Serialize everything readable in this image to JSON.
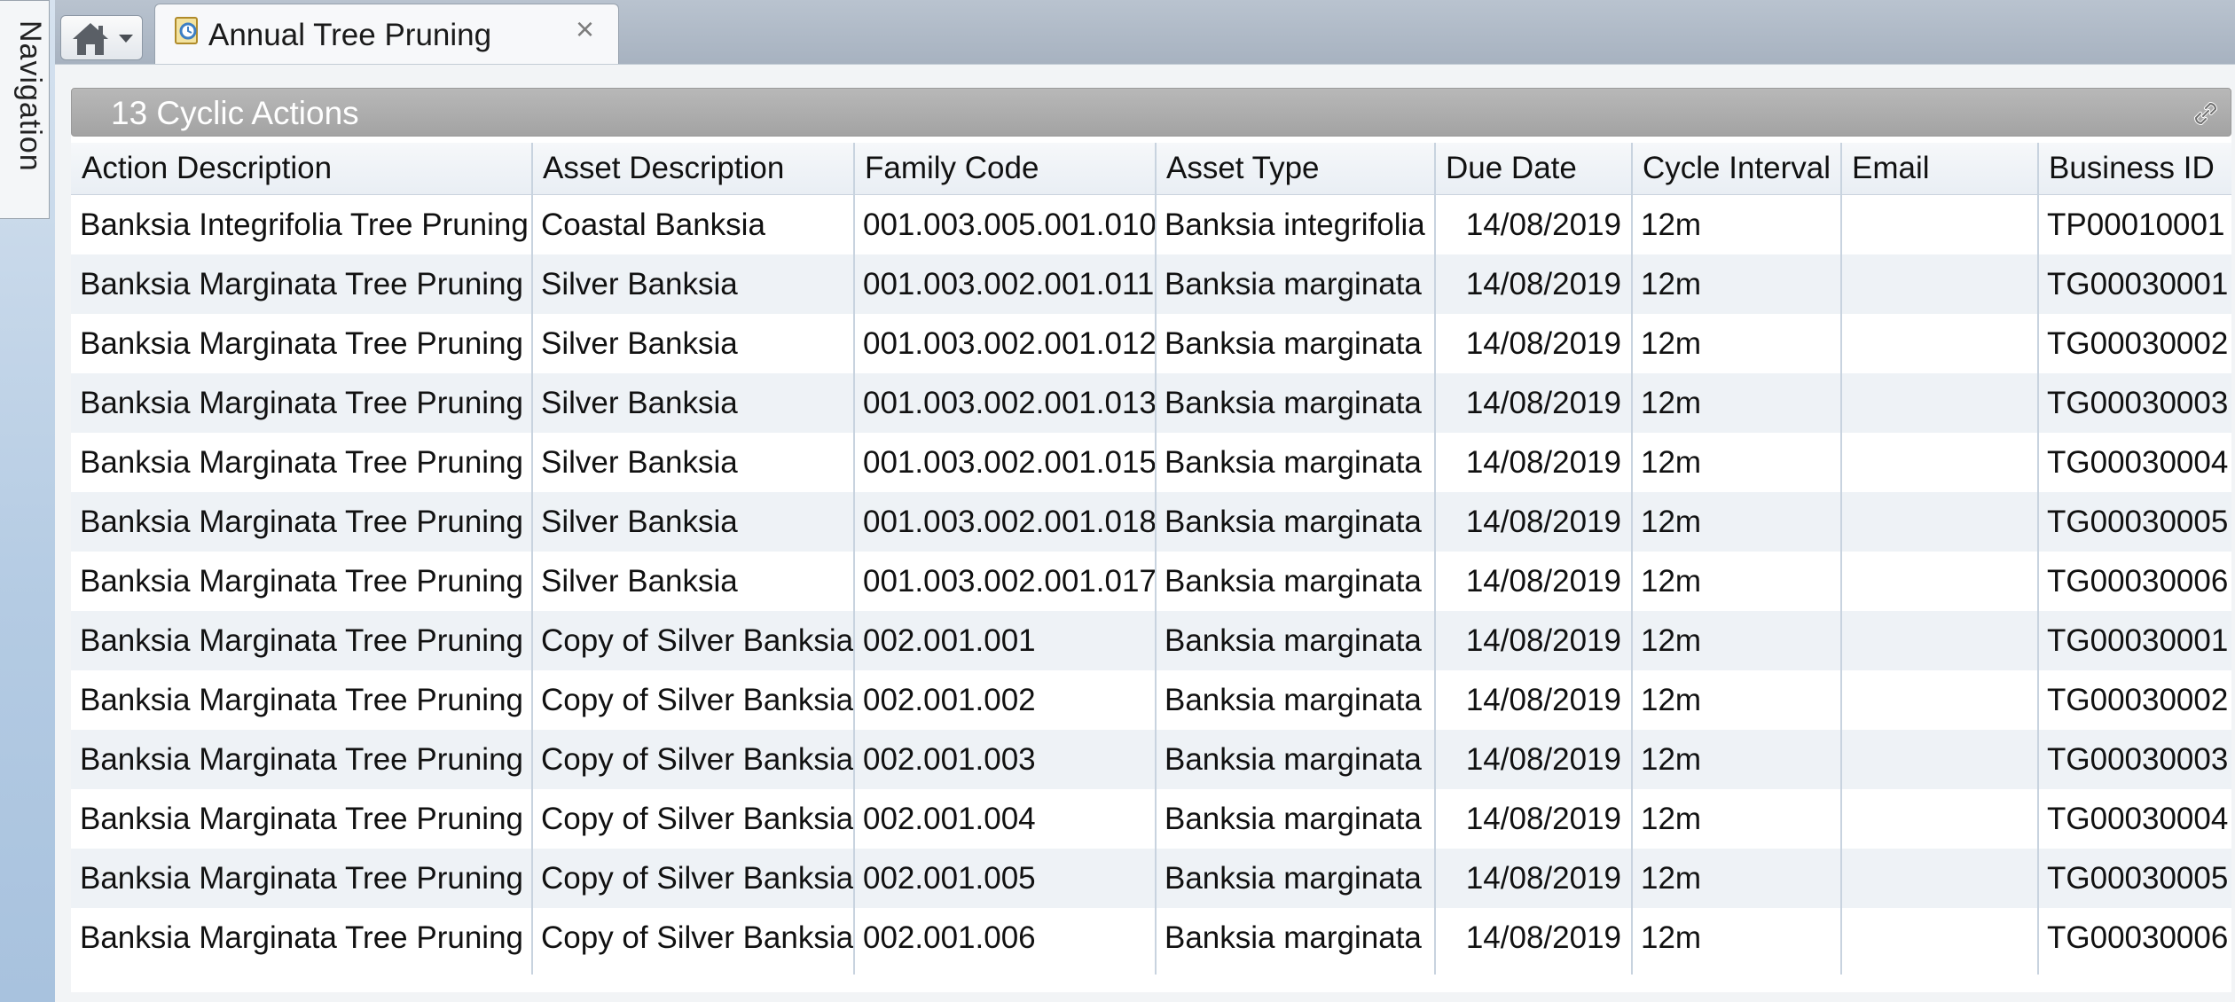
{
  "navigation": {
    "label": "Navigation"
  },
  "tabs": {
    "home_icon": "home-icon",
    "active": {
      "title": "Annual Tree Pruning",
      "icon": "cyclic-action-document-icon",
      "close": "×"
    }
  },
  "group": {
    "title": "13 Cyclic Actions",
    "link_icon": "link-icon"
  },
  "grid": {
    "columns": [
      "Action Description",
      "Asset Description",
      "Family Code",
      "Asset Type",
      "Due Date",
      "Cycle Interval",
      "Email",
      "Business ID"
    ],
    "rows": [
      [
        "Banksia Integrifolia Tree Pruning",
        "Coastal Banksia",
        "001.003.005.001.010",
        "Banksia integrifolia",
        "14/08/2019",
        "12m",
        "",
        "TP00010001"
      ],
      [
        "Banksia Marginata Tree Pruning",
        "Silver Banksia",
        "001.003.002.001.011",
        "Banksia marginata",
        "14/08/2019",
        "12m",
        "",
        "TG00030001"
      ],
      [
        "Banksia Marginata Tree Pruning",
        "Silver Banksia",
        "001.003.002.001.012",
        "Banksia marginata",
        "14/08/2019",
        "12m",
        "",
        "TG00030002"
      ],
      [
        "Banksia Marginata Tree Pruning",
        "Silver Banksia",
        "001.003.002.001.013",
        "Banksia marginata",
        "14/08/2019",
        "12m",
        "",
        "TG00030003"
      ],
      [
        "Banksia Marginata Tree Pruning",
        "Silver Banksia",
        "001.003.002.001.015",
        "Banksia marginata",
        "14/08/2019",
        "12m",
        "",
        "TG00030004"
      ],
      [
        "Banksia Marginata Tree Pruning",
        "Silver Banksia",
        "001.003.002.001.018",
        "Banksia marginata",
        "14/08/2019",
        "12m",
        "",
        "TG00030005"
      ],
      [
        "Banksia Marginata Tree Pruning",
        "Silver Banksia",
        "001.003.002.001.017",
        "Banksia marginata",
        "14/08/2019",
        "12m",
        "",
        "TG00030006"
      ],
      [
        "Banksia Marginata Tree Pruning",
        "Copy of Silver Banksia",
        "002.001.001",
        "Banksia marginata",
        "14/08/2019",
        "12m",
        "",
        "TG00030001"
      ],
      [
        "Banksia Marginata Tree Pruning",
        "Copy of Silver Banksia",
        "002.001.002",
        "Banksia marginata",
        "14/08/2019",
        "12m",
        "",
        "TG00030002"
      ],
      [
        "Banksia Marginata Tree Pruning",
        "Copy of Silver Banksia",
        "002.001.003",
        "Banksia marginata",
        "14/08/2019",
        "12m",
        "",
        "TG00030003"
      ],
      [
        "Banksia Marginata Tree Pruning",
        "Copy of Silver Banksia",
        "002.001.004",
        "Banksia marginata",
        "14/08/2019",
        "12m",
        "",
        "TG00030004"
      ],
      [
        "Banksia Marginata Tree Pruning",
        "Copy of Silver Banksia",
        "002.001.005",
        "Banksia marginata",
        "14/08/2019",
        "12m",
        "",
        "TG00030005"
      ],
      [
        "Banksia Marginata Tree Pruning",
        "Copy of Silver Banksia",
        "002.001.006",
        "Banksia marginata",
        "14/08/2019",
        "12m",
        "",
        "TG00030006"
      ]
    ]
  },
  "colors": {
    "header_bar": "#a9a9a9",
    "row_alt": "#eef2f6",
    "nav_rail": "#b4cbe3",
    "tabstrip": "#aeb8c5"
  }
}
